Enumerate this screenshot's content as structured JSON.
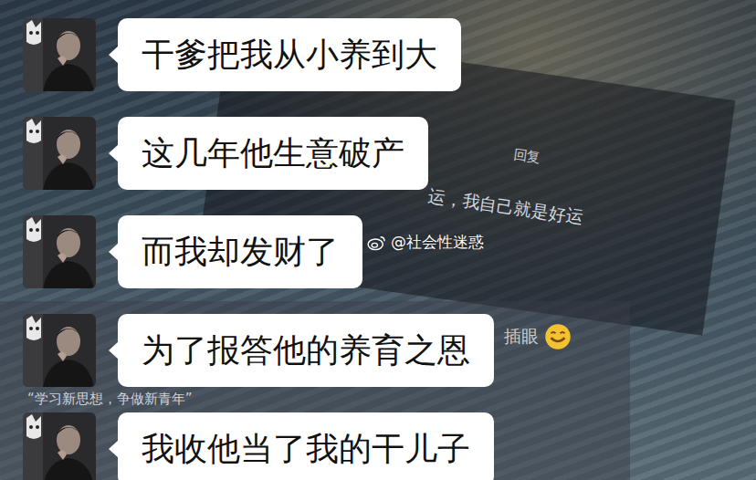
{
  "messages": [
    {
      "text": "干爹把我从小养到大"
    },
    {
      "text": "这几年他生意破产"
    },
    {
      "text": "而我却发财了"
    },
    {
      "text": "为了报答他的养育之恩"
    },
    {
      "text": "我收他当了我的干儿子"
    }
  ],
  "watermark": {
    "text": "@社会性迷惑"
  },
  "background": {
    "reply": "回复",
    "comment": "运，我自己就是好运",
    "tag": "插眼",
    "slogan": "“学习新思想，争做新青年”"
  }
}
